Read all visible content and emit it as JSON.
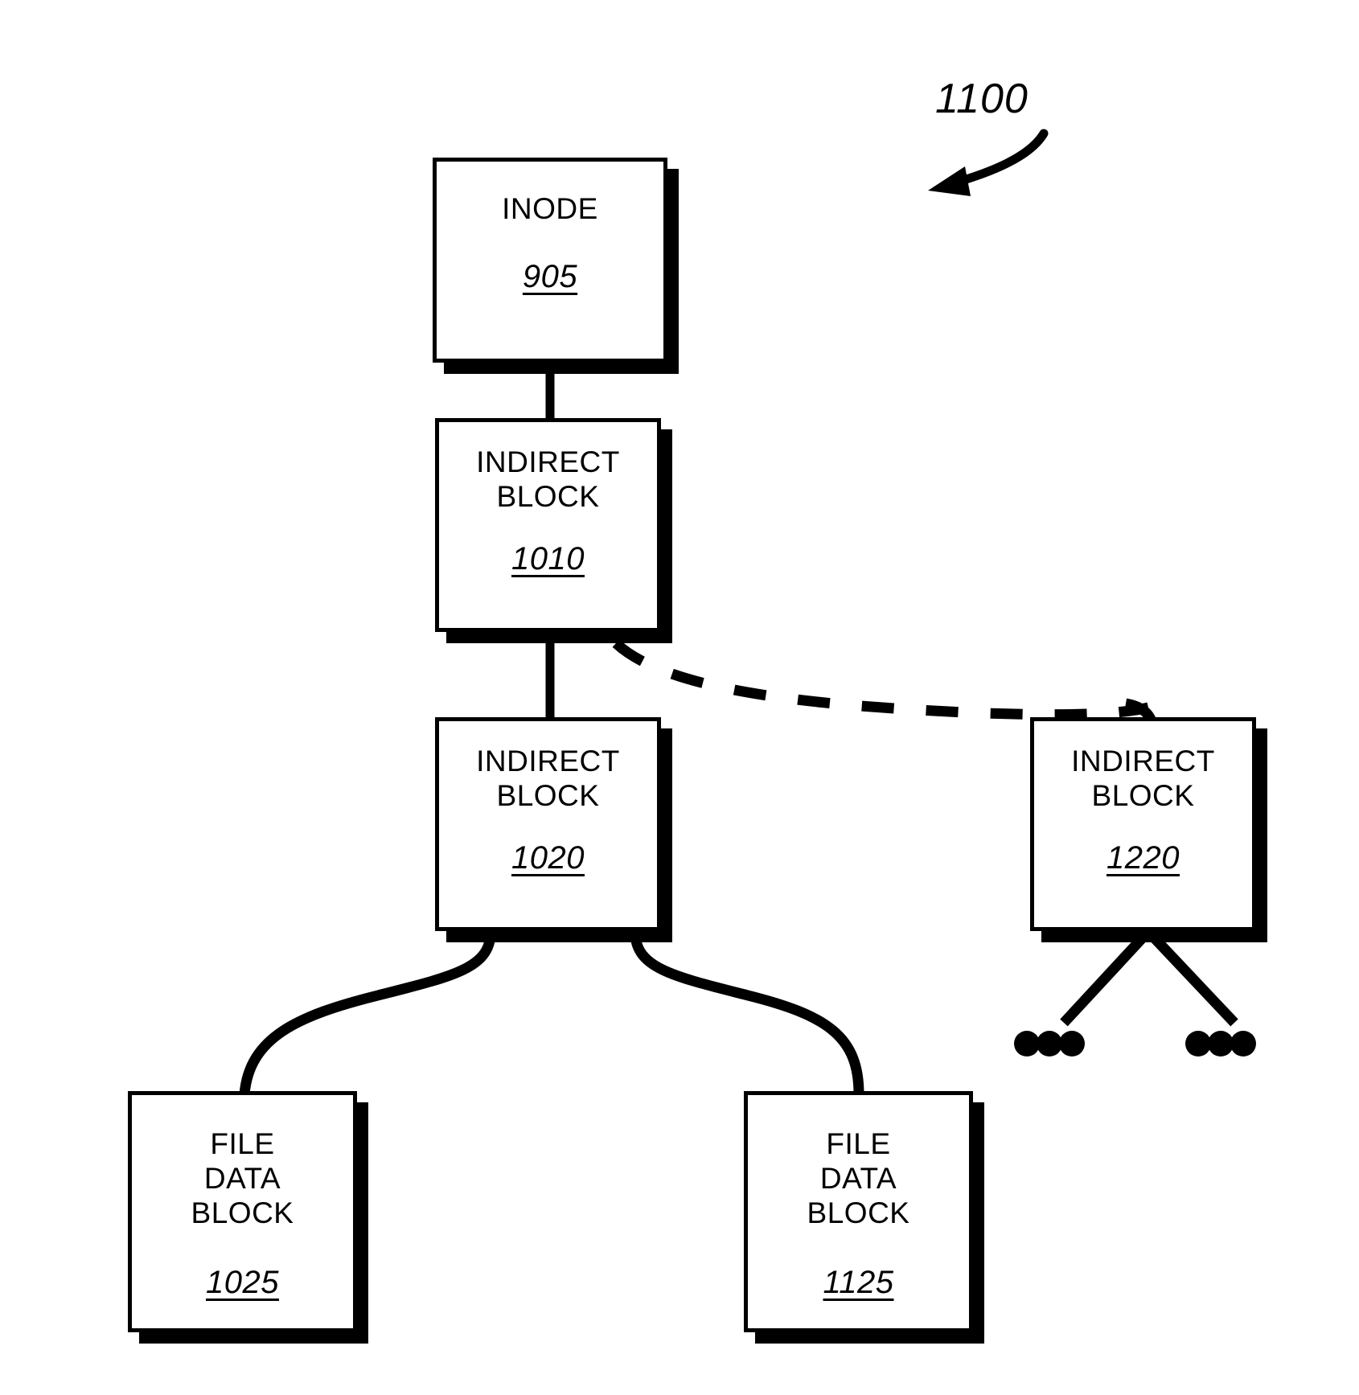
{
  "figure": {
    "number": "1100",
    "type": "patent-block-diagram",
    "title_text": "1100"
  },
  "nodes": [
    {
      "id": "inode-905",
      "title": "INODE",
      "reference": "905",
      "shape": "rectangle-with-drop-shadow"
    },
    {
      "id": "indirect-block-1010",
      "title": "INDIRECT\nBLOCK",
      "reference": "1010",
      "shape": "rectangle-with-drop-shadow"
    },
    {
      "id": "indirect-block-1020",
      "title": "INDIRECT\nBLOCK",
      "reference": "1020",
      "shape": "rectangle-with-drop-shadow"
    },
    {
      "id": "indirect-block-1220",
      "title": "INDIRECT\nBLOCK",
      "reference": "1220",
      "shape": "rectangle-with-drop-shadow"
    },
    {
      "id": "file-data-block-1025",
      "title": "FILE\nDATA\nBLOCK",
      "reference": "1025",
      "shape": "rectangle-with-drop-shadow"
    },
    {
      "id": "file-data-block-1125",
      "title": "FILE\nDATA\nBLOCK",
      "reference": "1125",
      "shape": "rectangle-with-drop-shadow"
    }
  ],
  "connectors": [
    {
      "from": "inode-905",
      "to": "indirect-block-1010",
      "style": "solid-straight"
    },
    {
      "from": "indirect-block-1010",
      "to": "indirect-block-1020",
      "style": "solid-straight"
    },
    {
      "from": "indirect-block-1010",
      "to": "indirect-block-1220",
      "style": "dashed-curve"
    },
    {
      "from": "indirect-block-1020",
      "to": "file-data-block-1025",
      "style": "solid-curve"
    },
    {
      "from": "indirect-block-1020",
      "to": "file-data-block-1125",
      "style": "solid-curve"
    },
    {
      "from": "indirect-block-1220",
      "to": "ellipsis-left",
      "style": "solid-diagonal"
    },
    {
      "from": "indirect-block-1220",
      "to": "ellipsis-right",
      "style": "solid-diagonal"
    }
  ],
  "ellipses": [
    {
      "id": "ellipsis-left",
      "dots": 3
    },
    {
      "id": "ellipsis-right",
      "dots": 3
    }
  ],
  "colors": {
    "stroke": "#000000",
    "fill": "#ffffff",
    "shadow": "#000000"
  }
}
